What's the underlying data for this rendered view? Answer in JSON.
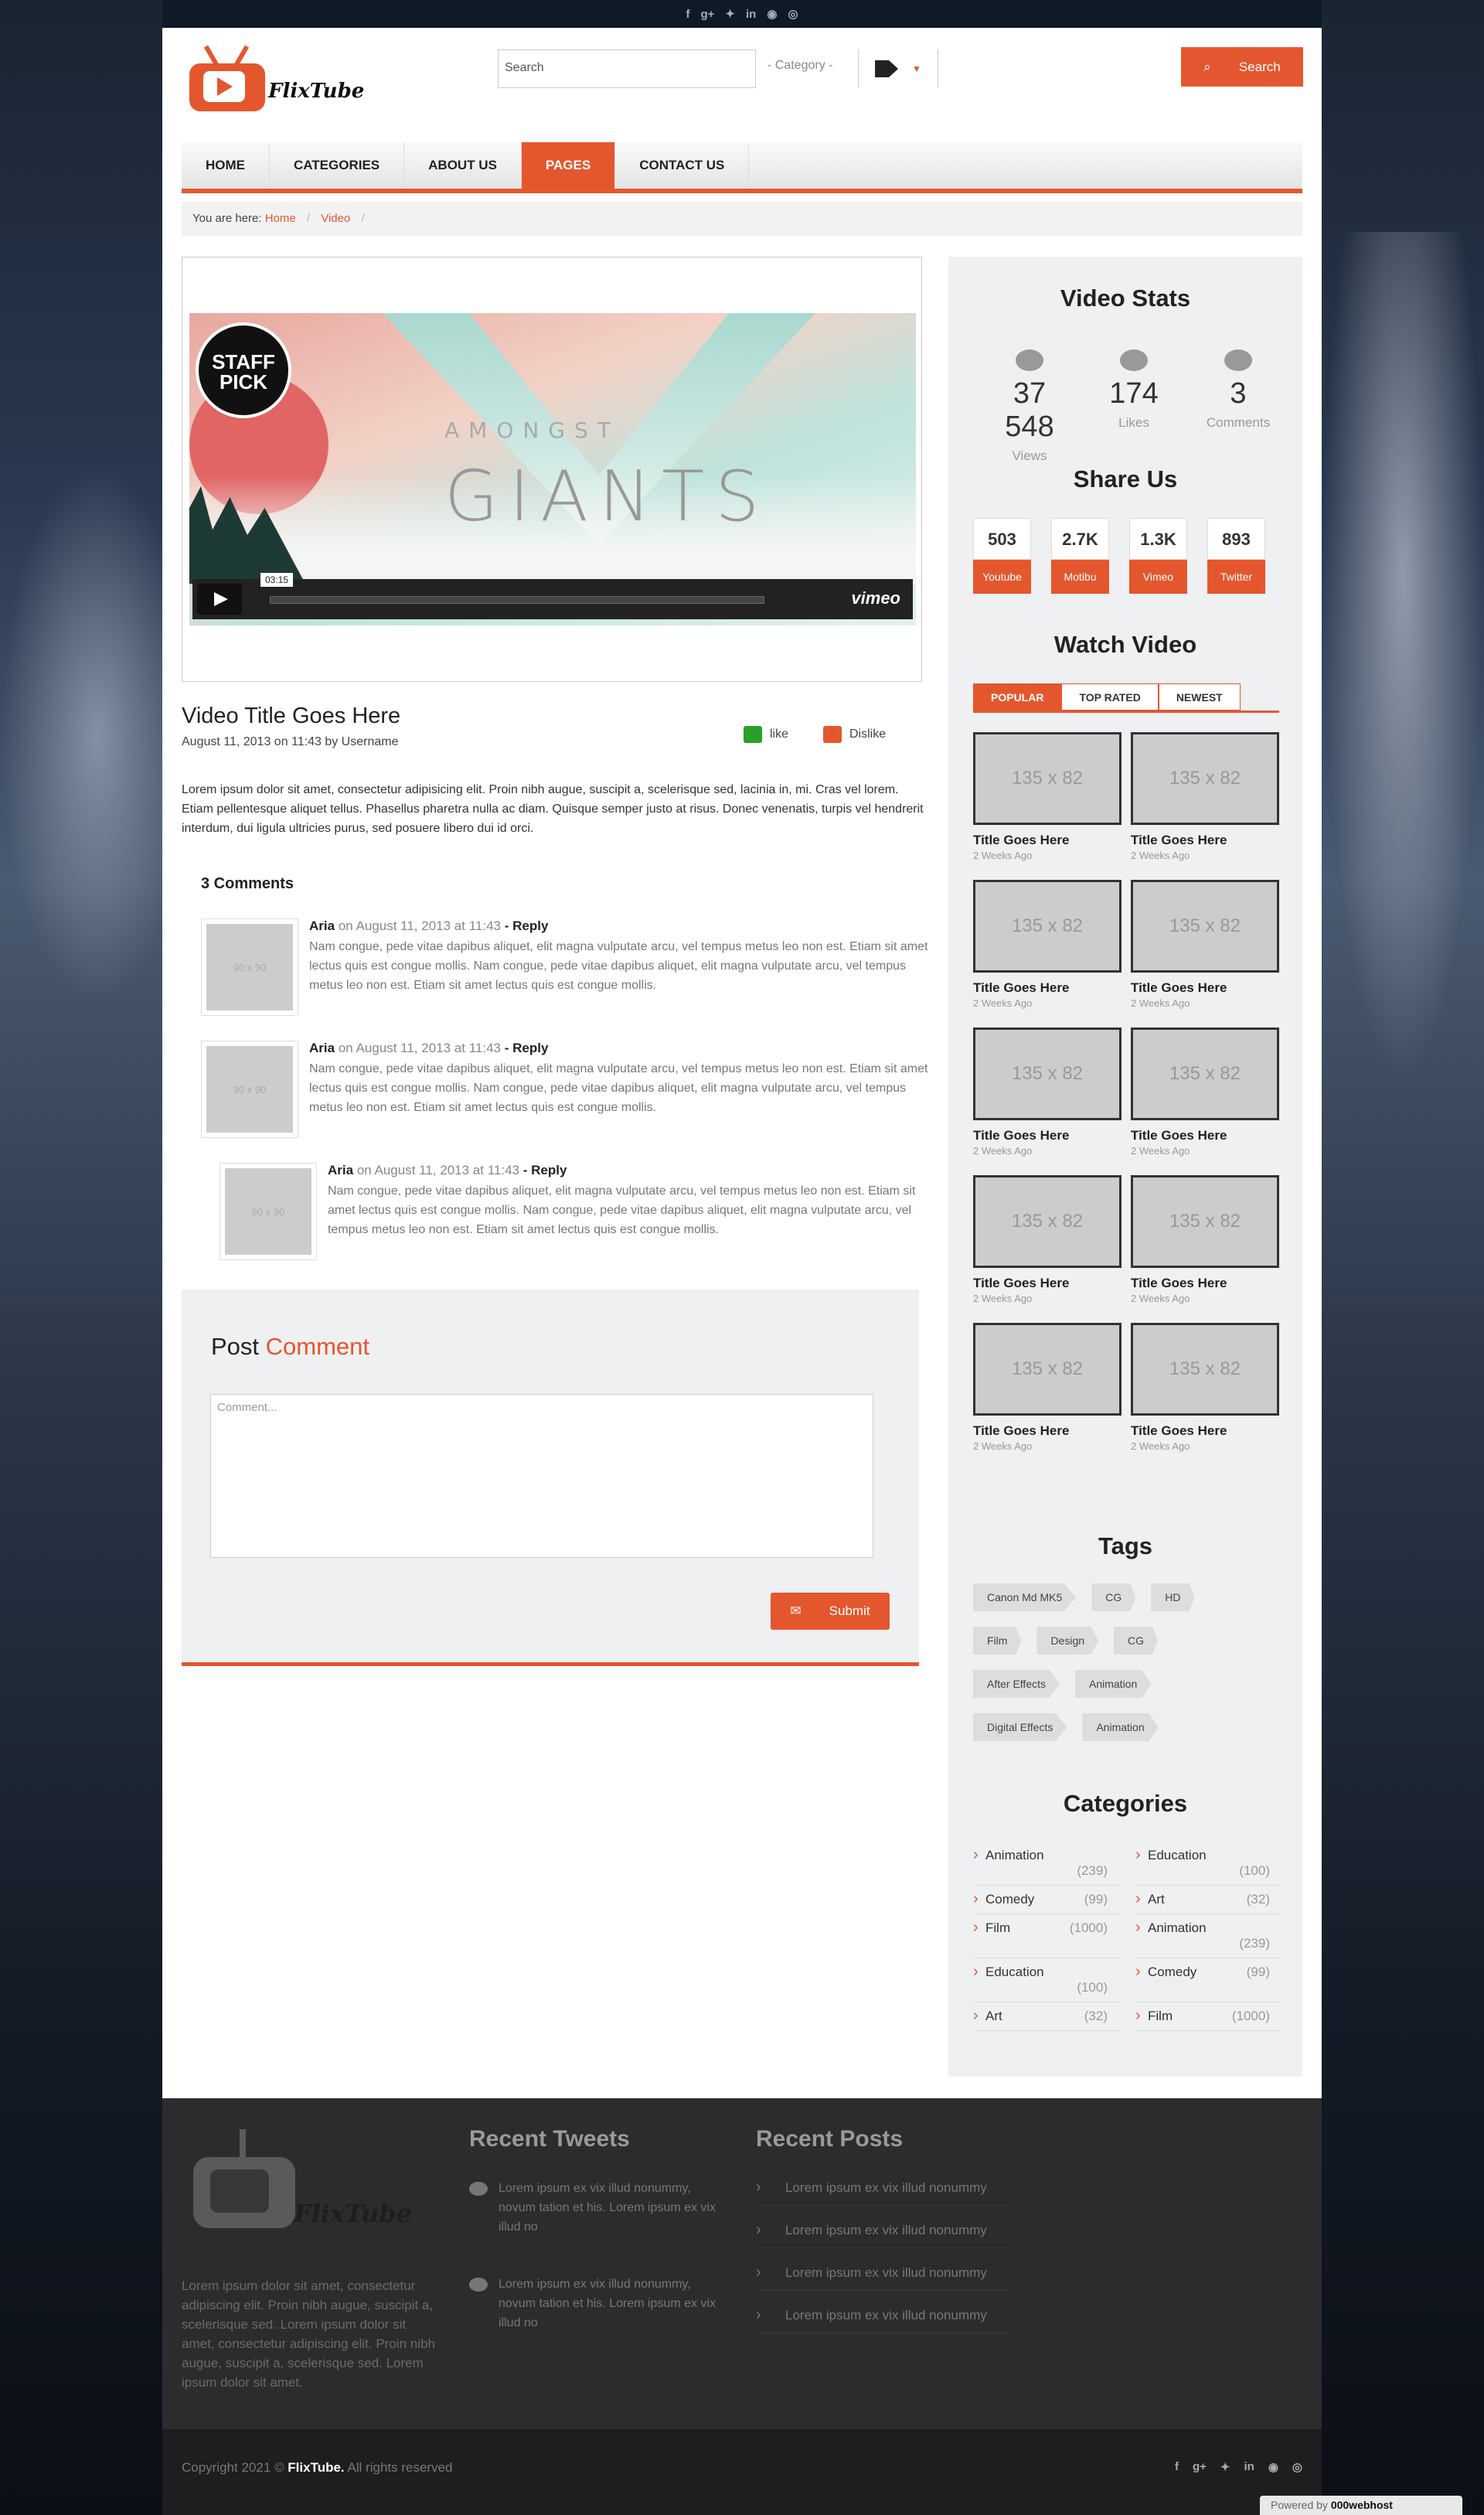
{
  "social_icons": [
    "f",
    "g+",
    "twitter",
    "in",
    "p",
    "d"
  ],
  "brand": {
    "name": "FlixTube",
    "accent": "#e4572e"
  },
  "header": {
    "search_placeholder": "Search",
    "category_label": "- Category -",
    "search_button": "Search"
  },
  "nav": [
    {
      "label": "HOME",
      "active": false
    },
    {
      "label": "CATEGORIES",
      "active": false
    },
    {
      "label": "ABOUT US",
      "active": false
    },
    {
      "label": "PAGES",
      "active": true
    },
    {
      "label": "CONTACT US",
      "active": false
    }
  ],
  "breadcrumb": {
    "prefix": "You are here:",
    "items": [
      "Home",
      "Video"
    ]
  },
  "video": {
    "art_line1": "AMONGST",
    "art_line2": "GIANTS",
    "badge": "STAFF PICK",
    "time": "03:15",
    "provider": "vimeo",
    "title": "Video Title Goes Here",
    "meta": "August 11, 2013 on 11:43 by Username",
    "like": "like",
    "dislike": "Dislike",
    "description": "Lorem ipsum dolor sit amet, consectetur adipisicing elit. Proin nibh augue, suscipit a, scelerisque sed, lacinia in, mi. Cras vel lorem. Etiam pellentesque aliquet tellus. Phasellus pharetra nulla ac diam. Quisque semper justo at risus. Donec venenatis, turpis vel hendrerit interdum, dui ligula ultricies purus, sed posuere libero dui id orci."
  },
  "comments": {
    "heading": "3 Comments",
    "items": [
      {
        "avatar": "90 x 90",
        "name": "Aria",
        "date": "on August 11, 2013 at 11:43",
        "reply": "- Reply",
        "text": "Nam congue, pede vitae dapibus aliquet, elit magna vulputate arcu, vel tempus metus leo non est. Etiam sit amet lectus quis est congue mollis. Nam congue, pede vitae dapibus aliquet, elit magna vulputate arcu, vel tempus metus leo non est. Etiam sit amet lectus quis est congue mollis."
      },
      {
        "avatar": "90 x 90",
        "name": "Aria",
        "date": "on August 11, 2013 at 11:43",
        "reply": "- Reply",
        "text": "Nam congue, pede vitae dapibus aliquet, elit magna vulputate arcu, vel tempus metus leo non est. Etiam sit amet lectus quis est congue mollis. Nam congue, pede vitae dapibus aliquet, elit magna vulputate arcu, vel tempus metus leo non est. Etiam sit amet lectus quis est congue mollis."
      },
      {
        "avatar": "90 x 90",
        "name": "Aria",
        "date": "on August 11, 2013 at 11:43",
        "reply": "- Reply",
        "text": "Nam congue, pede vitae dapibus aliquet, elit magna vulputate arcu, vel tempus metus leo non est. Etiam sit amet lectus quis est congue mollis. Nam congue, pede vitae dapibus aliquet, elit magna vulputate arcu, vel tempus metus leo non est. Etiam sit amet lectus quis est congue mollis."
      }
    ]
  },
  "post_comment": {
    "title_1": "Post",
    "title_2": "Comment",
    "placeholder": "Comment...",
    "submit": "Submit"
  },
  "sidebar": {
    "stats_title": "Video Stats",
    "stats": [
      {
        "icon": "eye-icon",
        "value": "37 548",
        "label": "Views"
      },
      {
        "icon": "thumbs-up-icon",
        "value": "174",
        "label": "Likes"
      },
      {
        "icon": "comments-icon",
        "value": "3",
        "label": "Comments"
      }
    ],
    "share_title": "Share Us",
    "shares": [
      {
        "count": "503",
        "label": "Youtube"
      },
      {
        "count": "2.7K",
        "label": "Motibu"
      },
      {
        "count": "1.3K",
        "label": "Vimeo"
      },
      {
        "count": "893",
        "label": "Twitter"
      }
    ],
    "watch_title": "Watch Video",
    "watch_tabs": [
      {
        "label": "POPULAR",
        "active": true
      },
      {
        "label": "TOP RATED",
        "active": false
      },
      {
        "label": "NEWEST",
        "active": false
      }
    ],
    "videos": [
      {
        "img": "135 x 82",
        "title": "Title Goes Here",
        "when": "2 Weeks Ago"
      },
      {
        "img": "135 x 82",
        "title": "Title Goes Here",
        "when": "2 Weeks Ago"
      },
      {
        "img": "135 x 82",
        "title": "Title Goes Here",
        "when": "2 Weeks Ago"
      },
      {
        "img": "135 x 82",
        "title": "Title Goes Here",
        "when": "2 Weeks Ago"
      },
      {
        "img": "135 x 82",
        "title": "Title Goes Here",
        "when": "2 Weeks Ago"
      },
      {
        "img": "135 x 82",
        "title": "Title Goes Here",
        "when": "2 Weeks Ago"
      },
      {
        "img": "135 x 82",
        "title": "Title Goes Here",
        "when": "2 Weeks Ago"
      },
      {
        "img": "135 x 82",
        "title": "Title Goes Here",
        "when": "2 Weeks Ago"
      },
      {
        "img": "135 x 82",
        "title": "Title Goes Here",
        "when": "2 Weeks Ago"
      },
      {
        "img": "135 x 82",
        "title": "Title Goes Here",
        "when": "2 Weeks Ago"
      }
    ],
    "tags_title": "Tags",
    "tags": [
      [
        "Canon Md MK5",
        "CG",
        "HD"
      ],
      [
        "Film",
        "Design",
        "CG"
      ],
      [
        "After Effects",
        "Animation"
      ],
      [
        "Digital Effects",
        "Animation"
      ]
    ],
    "categories_title": "Categories",
    "categories": [
      {
        "name": "Animation",
        "count": "(239)",
        "wrap": true
      },
      {
        "name": "Education",
        "count": "(100)",
        "wrap": true
      },
      {
        "name": "Comedy",
        "count": "(99)",
        "wrap": false
      },
      {
        "name": "Art",
        "count": "(32)",
        "wrap": false
      },
      {
        "name": "Film",
        "count": "(1000)",
        "wrap": false
      },
      {
        "name": "Animation",
        "count": "(239)",
        "wrap": true
      },
      {
        "name": "Education",
        "count": "(100)",
        "wrap": true
      },
      {
        "name": "Comedy",
        "count": "(99)",
        "wrap": false
      },
      {
        "name": "Art",
        "count": "(32)",
        "wrap": false
      },
      {
        "name": "Film",
        "count": "(1000)",
        "wrap": false
      }
    ]
  },
  "footer": {
    "about": "Lorem ipsum dolor sit amet, consectetur adipiscing elit. Proin nibh augue, suscipit a, scelerisque sed. Lorem ipsum dolor sit amet, consectetur adipiscing elit. Proin nibh augue, suscipit a, scelerisque sed. Lorem ipsum dolor sit amet.",
    "tweets_title": "Recent Tweets",
    "tweets": [
      "Lorem ipsum ex vix illud nonummy, novum tation et his. Lorem ipsum ex vix illud no",
      "Lorem ipsum ex vix illud nonummy, novum tation et his. Lorem ipsum ex vix illud no"
    ],
    "posts_title": "Recent Posts",
    "posts": [
      "Lorem ipsum ex vix illud nonummy",
      "Lorem ipsum ex vix illud nonummy",
      "Lorem ipsum ex vix illud nonummy",
      "Lorem ipsum ex vix illud nonummy"
    ],
    "copyright_prefix": "Copyright 2021 ©",
    "copyright_brand": "FlixTube.",
    "copyright_suffix": "All rights reserved",
    "powered_prefix": "Powered by",
    "powered_brand": "000webhost"
  }
}
